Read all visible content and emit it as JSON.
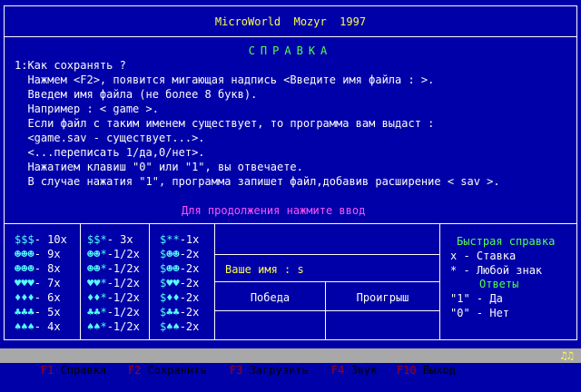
{
  "app_title": "MicroWorld  Mozyr  1997",
  "help": {
    "title": "СПРАВКА",
    "lines": [
      "1:Как сохранять ?",
      "  Нажмем <F2>, появится мигающая надпись <Введите имя файла : >.",
      "  Введем имя файла (не более 8 букв).",
      "  Например : < game >.",
      "  Если файл с таким именем существует, то программа вам выдаст :",
      "  <game.sav - существует...>.",
      "  <...переписать 1/да,0/нет>.",
      "  Нажатием клавиш \"0\" или \"1\", вы отвечаете.",
      "  В случае нажатия \"1\", программа запишет файл,добавив расширение < sav >."
    ],
    "continue_prompt": "Для продолжения нажмите ввод"
  },
  "paytable": {
    "col1": [
      "$$$- 10x",
      "☻☻☻- 9x",
      "☻☻☻- 8x",
      "♥♥♥- 7x",
      "♦♦♦- 6x",
      "♣♣♣- 5x",
      "♠♠♠- 4x"
    ],
    "col2": [
      "$$*- 3x",
      "☻☻*-1/2x",
      "☻☻*-1/2x",
      "♥♥*-1/2x",
      "♦♦*-1/2x",
      "♣♣*-1/2x",
      "♠♠*-1/2x"
    ],
    "col3": [
      "$**-1x",
      "$☻☻-2x",
      "$☻☻-2x",
      "$♥♥-2x",
      "$♦♦-2x",
      "$♣♣-2x",
      "$♠♠-2x"
    ]
  },
  "player": {
    "name_label": "Ваше имя : s",
    "win_label": "Победа",
    "loss_label": "Проигрыш"
  },
  "quick_help": {
    "title": "Быстрая справка",
    "lines": [
      "x - Ставка",
      "* - Любой знак"
    ],
    "answers_title": "Ответы",
    "answers": [
      "\"1\" - Да",
      "\"0\" - Нет"
    ]
  },
  "menubar": {
    "items": [
      {
        "key": "F1",
        "label": " Справка"
      },
      {
        "key": "F2",
        "label": " Сохранить"
      },
      {
        "key": "F3",
        "label": " Загрузить"
      },
      {
        "key": "F4",
        "label": " Звук"
      },
      {
        "key": "F10",
        "label": " Выход"
      }
    ],
    "indicator": "♫♫"
  },
  "colors": {
    "background": "#0000a8",
    "text": "#fcfcfc",
    "title": "#fcfc54",
    "accent_green": "#54fc54",
    "prompt": "#fc54fc",
    "menubar": "#a8a8a8",
    "menu_key": "#a80000"
  }
}
